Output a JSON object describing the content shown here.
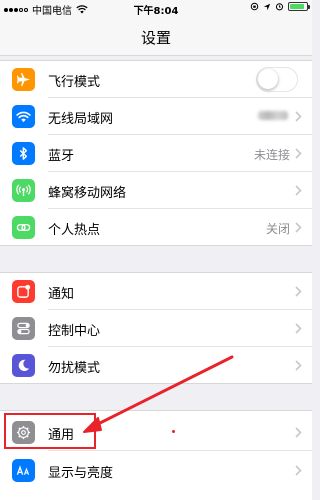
{
  "status_bar": {
    "carrier": "中国电信",
    "time": "下午8:04",
    "battery_color": "#4cd964",
    "battery_level_fraction": 0.9
  },
  "nav": {
    "title": "设置"
  },
  "groups": [
    {
      "rows": [
        {
          "label": "飞行模式",
          "icon": "airplane-icon",
          "icon_color": "#ff9500",
          "accessory": "toggle",
          "toggle_on": false
        },
        {
          "label": "无线局域网",
          "icon": "wifi-icon",
          "icon_color": "#007aff",
          "accessory": "blurred-value"
        },
        {
          "label": "蓝牙",
          "icon": "bluetooth-icon",
          "icon_color": "#007aff",
          "value": "未连接"
        },
        {
          "label": "蜂窝移动网络",
          "icon": "cellular-icon",
          "icon_color": "#4cd964"
        },
        {
          "label": "个人热点",
          "icon": "hotspot-icon",
          "icon_color": "#4cd964",
          "value": "关闭"
        }
      ]
    },
    {
      "rows": [
        {
          "label": "通知",
          "icon": "notifications-icon",
          "icon_color": "#ff3b30"
        },
        {
          "label": "控制中心",
          "icon": "control-center-icon",
          "icon_color": "#8e8e93"
        },
        {
          "label": "勿扰模式",
          "icon": "moon-icon",
          "icon_color": "#5856d6"
        }
      ]
    },
    {
      "rows": [
        {
          "label": "通用",
          "icon": "gear-icon",
          "icon_color": "#8e8e93"
        },
        {
          "label": "显示与亮度",
          "icon": "display-brightness-icon",
          "icon_color": "#007aff"
        }
      ]
    }
  ],
  "annotation": {
    "color": "#e8232a"
  }
}
